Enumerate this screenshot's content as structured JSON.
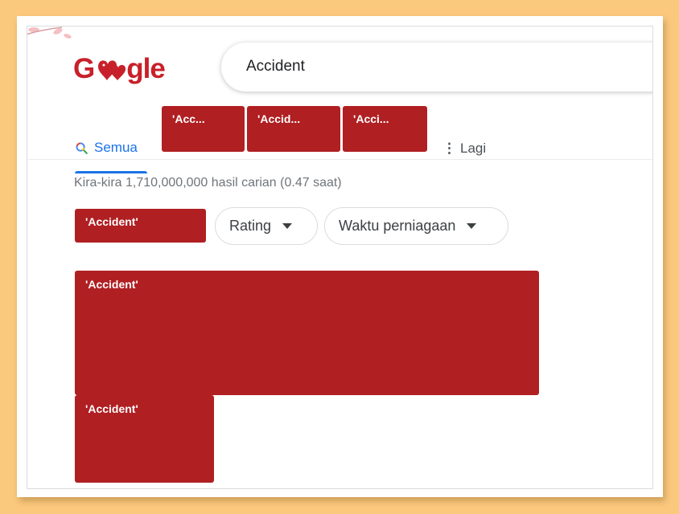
{
  "logo": {
    "text_left": "G",
    "text_right": "gle"
  },
  "search": {
    "query": "Accident"
  },
  "tabs": {
    "all_label": "Semua",
    "redacted": [
      "'Acc...",
      "'Accid...",
      "'Acci..."
    ],
    "more_label": "Lagi"
  },
  "results_stats": "Kira-kira 1,710,000,000 hasil carian (0.47 saat)",
  "filters": {
    "redacted_chip": "'Accident'",
    "rating_label": "Rating",
    "hours_label": "Waktu perniagaan"
  },
  "blocks": {
    "main": "'Accident'",
    "small": "'Accident'"
  },
  "colors": {
    "redaction": "#b01f22",
    "accent": "#1a73e8",
    "logo": "#c8202a",
    "frame": "#fbc97e"
  }
}
